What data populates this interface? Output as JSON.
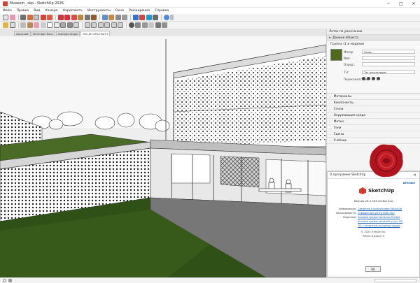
{
  "window": {
    "title": "Museum_.skp - SketchUp 2026",
    "minimize": "─",
    "maximize": "□",
    "close": "✕"
  },
  "menu": [
    "Файл",
    "Правка",
    "Вид",
    "Камера",
    "Нарисовать",
    "Инструменты",
    "Окно",
    "Расширения",
    "Справка"
  ],
  "scene_tabs": [
    "Аэрсский",
    "Интегрик Коси",
    "Лиазуре Андре",
    "SEC-KH ОРАСТЫП 3"
  ],
  "panel": {
    "tray_title": "Лоток по умолчанию",
    "entity_info": {
      "header": "Данные объекта",
      "group_label": "Группа (1 в модели)",
      "material_label": "Матер:",
      "material_value": "Grass",
      "name_label": "Имя:",
      "name_value": "",
      "def_label": "Опред.:",
      "def_value": "",
      "type_label": "Тэг:",
      "type_value": "Тэг отсутствует",
      "toggles_label": "Переключатели:"
    },
    "trays": [
      "Материалы",
      "Компоненты",
      "Стили",
      "Окружающая среда",
      "Метки",
      "Тени",
      "Сцены",
      "Учебник"
    ]
  },
  "about": {
    "title": "О программе SketchUp",
    "close": "✕",
    "brand": "◆Trimble",
    "product": "SketchUp",
    "version": "Версия 26.1.189 64-битная",
    "rows": [
      {
        "k": "Информация:",
        "v": "Сведения о приложении SketchUp"
      },
      {
        "k": "Тикозадеректи:",
        "v": "Справочный центр SketchUp"
      },
      {
        "k": "Лицензия:",
        "v": "Условия предоставления Trimble"
      },
      {
        "k": "",
        "v": "Условия предоставления услуг API"
      },
      {
        "k": "",
        "v": "ПО с открытым исходным кодом"
      }
    ],
    "copyright": "© 2025 Trimble Inc.",
    "build": "Patent 6,628,279",
    "ok": "OK"
  },
  "status": {
    "measurements": ""
  },
  "colors": {
    "grass": "#4e6a1e",
    "seal": "#b0141e",
    "sketchup_red": "#d33a2c"
  }
}
